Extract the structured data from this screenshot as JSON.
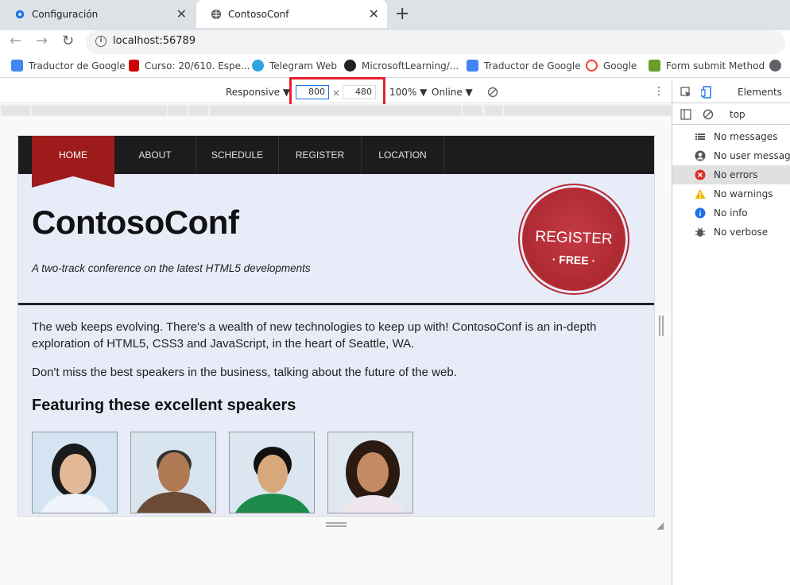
{
  "browser": {
    "tabs": [
      {
        "title": "Configuración",
        "icon": "gear-icon"
      },
      {
        "title": "ContosoConf",
        "icon": "globe-icon"
      }
    ],
    "close_glyph": "✕",
    "new_tab_glyph": "+",
    "url": "localhost:56789",
    "bookmarks": [
      {
        "label": "Traductor de Google",
        "icon": "google-translate-icon"
      },
      {
        "label": "Curso: 20/610. Espe...",
        "icon": "ni-icon"
      },
      {
        "label": "Telegram Web",
        "icon": "telegram-icon"
      },
      {
        "label": "MicrosoftLearning/...",
        "icon": "github-icon"
      },
      {
        "label": "Traductor de Google",
        "icon": "google-translate-icon"
      },
      {
        "label": "Google",
        "icon": "google-icon"
      },
      {
        "label": "Form submit Method",
        "icon": "w3-icon"
      }
    ]
  },
  "device_toolbar": {
    "mode": "Responsive ▼",
    "width": "800",
    "times": "×",
    "height": "480",
    "zoom": "100% ▼",
    "network": "Online ▼"
  },
  "site": {
    "nav": [
      "HOME",
      "ABOUT",
      "SCHEDULE",
      "REGISTER",
      "LOCATION"
    ],
    "title": "ContosoConf",
    "tagline": "A two-track conference on the latest HTML5 developments",
    "badge_main": "REGISTER",
    "badge_sub": "· FREE ·",
    "para1": "The web keeps evolving. There's a wealth of new technologies to keep up with! ContosoConf is an in-depth exploration of HTML5, CSS3 and JavaScript, in the heart of Seattle, WA.",
    "para2": "Don't miss the best speakers in the business, talking about the future of the web.",
    "speakers_heading": "Featuring these excellent speakers"
  },
  "devtools": {
    "tab": "Elements",
    "context": "top",
    "console_filters": [
      {
        "label": "No messages",
        "icon": "list-icon"
      },
      {
        "label": "No user messages",
        "icon": "user-icon"
      },
      {
        "label": "No errors",
        "icon": "error-icon",
        "color": "#d93025"
      },
      {
        "label": "No warnings",
        "icon": "warning-icon",
        "color": "#f2b600"
      },
      {
        "label": "No info",
        "icon": "info-icon",
        "color": "#1a73e8"
      },
      {
        "label": "No verbose",
        "icon": "bug-icon"
      }
    ]
  }
}
